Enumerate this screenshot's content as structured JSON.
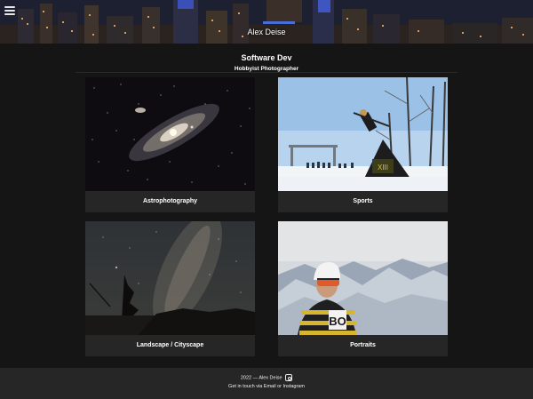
{
  "header": {
    "site_title": "Alex Deise"
  },
  "subheader": {
    "title": "Software Dev",
    "tagline": "Hobbyist Photographer"
  },
  "gallery": [
    {
      "label": "Astrophotography"
    },
    {
      "label": "Sports"
    },
    {
      "label": "Landscape / Cityscape"
    },
    {
      "label": "Portraits"
    }
  ],
  "footer": {
    "copyright": "2022 — Alex Deise",
    "contact": "Get in touch via Email or Instagram"
  },
  "icons": {
    "menu": "hamburger-menu-icon",
    "instagram": "instagram-icon"
  }
}
